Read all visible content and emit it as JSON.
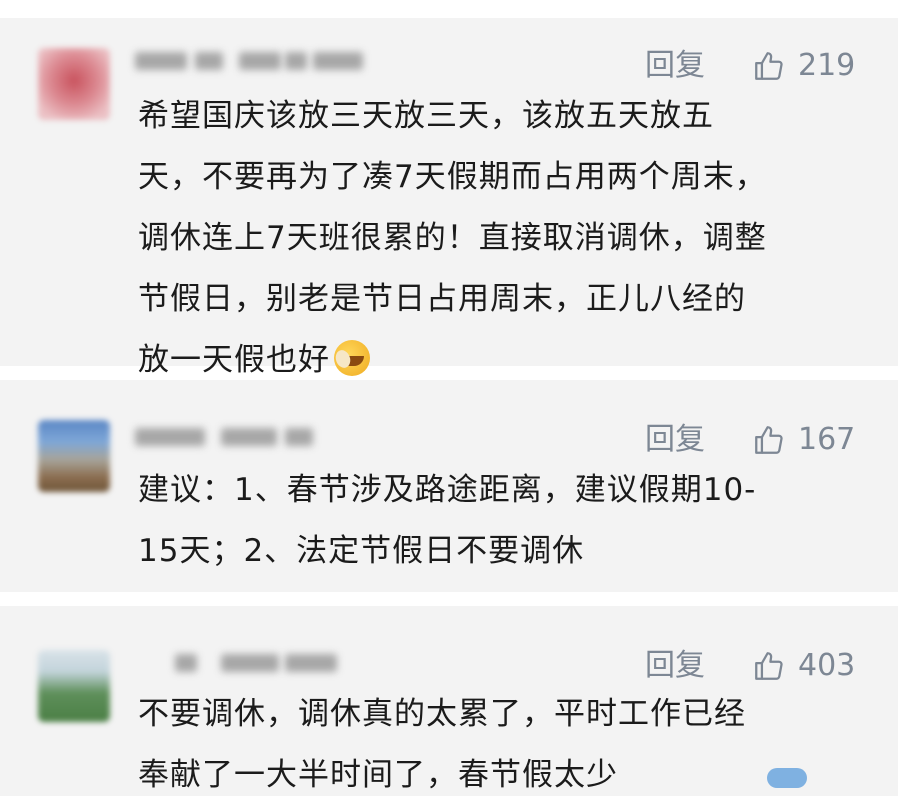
{
  "comments": [
    {
      "reply_label": "回复",
      "likes": "219",
      "lines": [
        "希望国庆该放三天放三天，该放五天放五",
        "天，不要再为了凑7天假期而占用两个周末，",
        "调休连上7天班很累的！直接取消调休，调整",
        "节假日，别老是节日占用周末，正儿八经的",
        "放一天假也好"
      ],
      "emoji": "crying-laughing-emoji"
    },
    {
      "reply_label": "回复",
      "likes": "167",
      "lines": [
        "建议：1、春节涉及路途距离，建议假期10-",
        "15天；2、法定节假日不要调休"
      ]
    },
    {
      "reply_label": "回复",
      "likes": "403",
      "lines": [
        "不要调休，调休真的太累了，平时工作已经",
        "奉献了一大半时间了，春节假太少"
      ]
    }
  ],
  "icons": {
    "like": "thumbs-up-icon"
  },
  "colors": {
    "card_bg": "#f3f3f3",
    "meta_text": "#7d8794",
    "body_text": "#1b1b1b"
  }
}
